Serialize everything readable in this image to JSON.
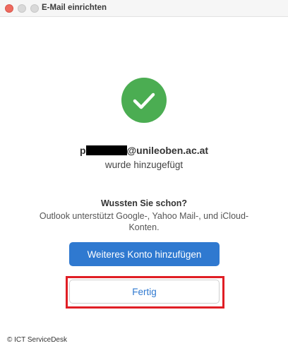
{
  "window": {
    "title": "E-Mail einrichten"
  },
  "status": {
    "email_prefix": "p",
    "email_domain": "@unileoben.ac.at",
    "added_text": "wurde hinzugefügt",
    "icon": "checkmark-icon",
    "success_color": "#4bad52"
  },
  "tip": {
    "heading": "Wussten Sie schon?",
    "body": "Outlook unterstützt Google-, Yahoo Mail-, und iCloud-Konten."
  },
  "buttons": {
    "add_account_label": "Weiteres Konto hinzufügen",
    "done_label": "Fertig",
    "accent_color": "#2f79d0"
  },
  "footer": {
    "copyright": "© ICT ServiceDesk"
  }
}
